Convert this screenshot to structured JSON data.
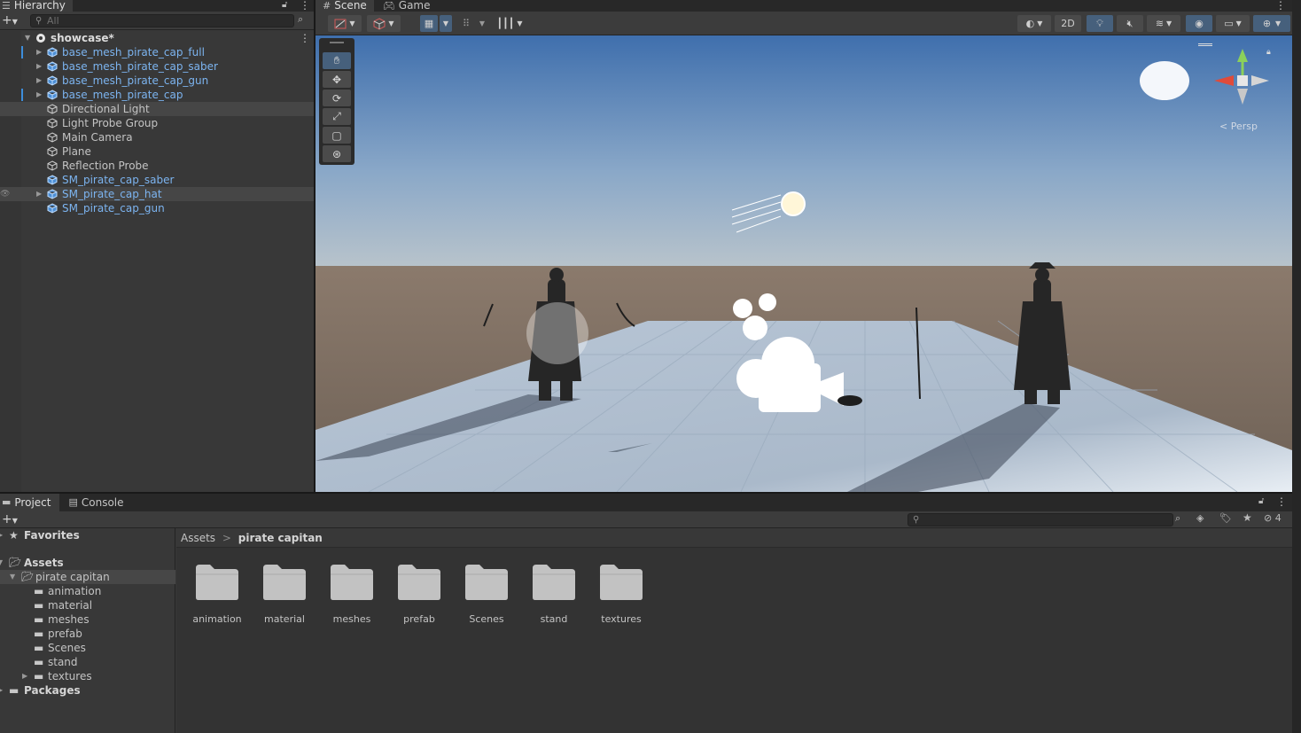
{
  "hierarchy": {
    "tab_label": "Hierarchy",
    "search_placeholder": "All",
    "scene_name": "showcase*",
    "items": [
      {
        "label": "base_mesh_pirate_cap_full",
        "prefab": true,
        "expandable": true
      },
      {
        "label": "base_mesh_pirate_cap_saber",
        "prefab": true,
        "expandable": true
      },
      {
        "label": "base_mesh_pirate_cap_gun",
        "prefab": true,
        "expandable": true
      },
      {
        "label": "base_mesh_pirate_cap",
        "prefab": true,
        "expandable": true
      },
      {
        "label": "Directional Light",
        "prefab": false,
        "expandable": false
      },
      {
        "label": "Light Probe Group",
        "prefab": false,
        "expandable": false
      },
      {
        "label": "Main Camera",
        "prefab": false,
        "expandable": false
      },
      {
        "label": "Plane",
        "prefab": false,
        "expandable": false
      },
      {
        "label": "Reflection Probe",
        "prefab": false,
        "expandable": false
      },
      {
        "label": "SM_pirate_cap_saber",
        "prefab": true,
        "expandable": false
      },
      {
        "label": "SM_pirate_cap_hat",
        "prefab": true,
        "expandable": true
      },
      {
        "label": "SM_pirate_cap_gun",
        "prefab": true,
        "expandable": false
      }
    ]
  },
  "scene_view": {
    "tabs": [
      {
        "label": "Scene",
        "icon": "grid-icon",
        "active": true
      },
      {
        "label": "Game",
        "icon": "gamepad-icon",
        "active": false
      }
    ],
    "toolbar": {
      "mode_2d_label": "2D"
    },
    "gizmo_label": "< Persp"
  },
  "project": {
    "tabs": [
      {
        "label": "Project",
        "icon": "folder-icon",
        "active": true
      },
      {
        "label": "Console",
        "icon": "console-icon",
        "active": false
      }
    ],
    "hidden_count": "4",
    "favorites_label": "Favorites",
    "assets_label": "Assets",
    "selected_folder": "pirate capitan",
    "subfolders": [
      "animation",
      "material",
      "meshes",
      "prefab",
      "Scenes",
      "stand",
      "textures"
    ],
    "packages_label": "Packages",
    "breadcrumb": {
      "root": "Assets",
      "separator": ">",
      "current": "pirate capitan"
    },
    "grid_items": [
      "animation",
      "material",
      "meshes",
      "prefab",
      "Scenes",
      "stand",
      "textures"
    ]
  },
  "colors": {
    "prefab_text": "#7cb4f0",
    "selection_blue": "#46607c",
    "sky_top": "#3f6fad",
    "ground": "#6e6156",
    "plane": "#b8c6d6"
  }
}
